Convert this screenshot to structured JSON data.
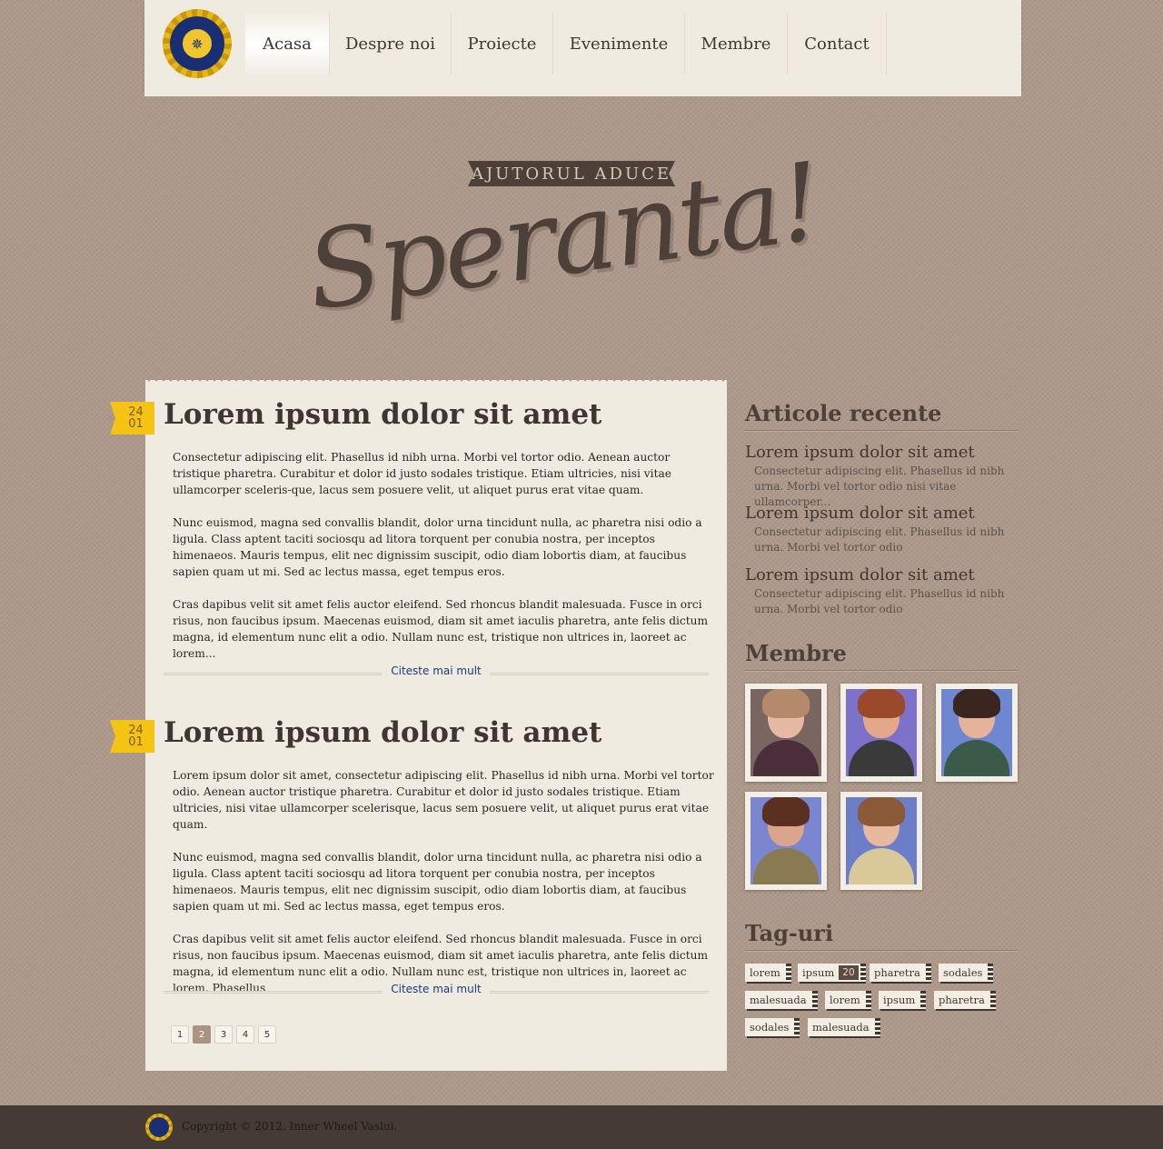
{
  "header": {
    "logo_label": "Inner Wheel",
    "nav": [
      {
        "label": "Acasa",
        "active": true
      },
      {
        "label": "Despre noi",
        "active": false
      },
      {
        "label": "Proiecte",
        "active": false
      },
      {
        "label": "Evenimente",
        "active": false
      },
      {
        "label": "Membre",
        "active": false
      },
      {
        "label": "Contact",
        "active": false
      }
    ]
  },
  "hero": {
    "ribbon": "AJUTORUL ADUCE",
    "script": "Speranta!"
  },
  "posts": [
    {
      "date_day": "24",
      "date_month": "01",
      "title": "Lorem ipsum dolor sit amet",
      "paragraphs": [
        "Consectetur adipiscing elit. Phasellus id nibh urna. Morbi vel tortor odio. Aenean auctor tristique pharetra. Curabitur et dolor id justo sodales tristique. Etiam ultricies, nisi vitae ullamcorper sceleris-que, lacus sem posuere velit, ut aliquet purus erat vitae quam.",
        "Nunc euismod, magna sed convallis blandit, dolor urna tincidunt nulla, ac pharetra nisi odio a ligula. Class aptent taciti sociosqu ad litora torquent per conubia nostra, per inceptos himenaeos. Mauris tempus, elit nec dignissim suscipit, odio diam lobortis diam, at faucibus sapien quam ut mi. Sed ac lectus massa, eget tempus eros.",
        "Cras dapibus velit sit amet felis auctor eleifend. Sed rhoncus blandit malesuada. Fusce in orci risus, non faucibus ipsum. Maecenas euismod, diam sit amet iaculis pharetra, ante felis dictum magna, id elementum nunc elit a odio. Nullam nunc est, tristique non ultrices in, laoreet ac lorem..."
      ],
      "read_more": "Citeste mai mult"
    },
    {
      "date_day": "24",
      "date_month": "01",
      "title": "Lorem ipsum dolor sit amet",
      "paragraphs": [
        "Lorem ipsum dolor sit amet, consectetur adipiscing elit. Phasellus id nibh urna. Morbi vel tortor odio. Aenean auctor tristique pharetra. Curabitur et dolor id justo sodales tristique. Etiam ultricies, nisi vitae ullamcorper scelerisque, lacus sem posuere velit, ut aliquet purus erat vitae quam.",
        "Nunc euismod, magna sed convallis blandit, dolor urna tincidunt nulla, ac pharetra nisi odio a ligula. Class aptent taciti sociosqu ad litora torquent per conubia nostra, per inceptos himenaeos. Mauris tempus, elit nec dignissim suscipit, odio diam lobortis diam, at faucibus sapien quam ut mi. Sed ac lectus massa, eget tempus eros.",
        "Cras dapibus velit sit amet felis auctor eleifend. Sed rhoncus blandit malesuada. Fusce in orci risus, non faucibus ipsum. Maecenas euismod, diam sit amet iaculis pharetra, ante felis dictum magna, id elementum nunc elit a odio. Nullam nunc est, tristique non ultrices in, laoreet ac lorem. Phasellus"
      ],
      "read_more": "Citeste mai mult"
    }
  ],
  "pagination": {
    "pages": [
      "1",
      "2",
      "3",
      "4",
      "5"
    ],
    "current": "2"
  },
  "sidebar": {
    "recent_heading": "Articole recente",
    "recent": [
      {
        "title": "Lorem ipsum dolor sit amet",
        "excerpt": "Consectetur adipiscing elit. Phasellus id nibh urna. Morbi vel tortor odio nisi vitae ullamcorper..."
      },
      {
        "title": "Lorem ipsum dolor sit amet",
        "excerpt": "Consectetur adipiscing elit. Phasellus id nibh urna. Morbi vel tortor odio"
      },
      {
        "title": "Lorem ipsum dolor sit amet",
        "excerpt": "Consectetur adipiscing elit. Phasellus id nibh urna. Morbi vel tortor odio"
      }
    ],
    "members_heading": "Membre",
    "members": [
      {
        "bg": "#7a6660",
        "hair": "#b58a6a",
        "skin": "#e6b9a4",
        "clothes": "#4a2f3a"
      },
      {
        "bg": "#7c72c9",
        "hair": "#9a4a2a",
        "skin": "#e2a889",
        "clothes": "#3a3a3a"
      },
      {
        "bg": "#6f86d0",
        "hair": "#3a2520",
        "skin": "#e4b39a",
        "clothes": "#3b5a48"
      },
      {
        "bg": "#7a86d0",
        "hair": "#5a3020",
        "skin": "#dba58c",
        "clothes": "#8a7a52"
      },
      {
        "bg": "#6c7ec8",
        "hair": "#8a5a38",
        "skin": "#e7b99e",
        "clothes": "#d8c89a"
      }
    ],
    "tags_heading": "Tag-uri",
    "tags": [
      {
        "label": "lorem"
      },
      {
        "label": "ipsum",
        "count": "20"
      },
      {
        "label": "pharetra"
      },
      {
        "label": "sodales"
      },
      {
        "label": "malesuada"
      },
      {
        "label": "lorem"
      },
      {
        "label": "ipsum"
      },
      {
        "label": "pharetra"
      },
      {
        "label": "sodales"
      },
      {
        "label": "malesuada"
      }
    ]
  },
  "footer": {
    "copyright": "Copyright © 2012. Inner Wheel Vaslui."
  }
}
